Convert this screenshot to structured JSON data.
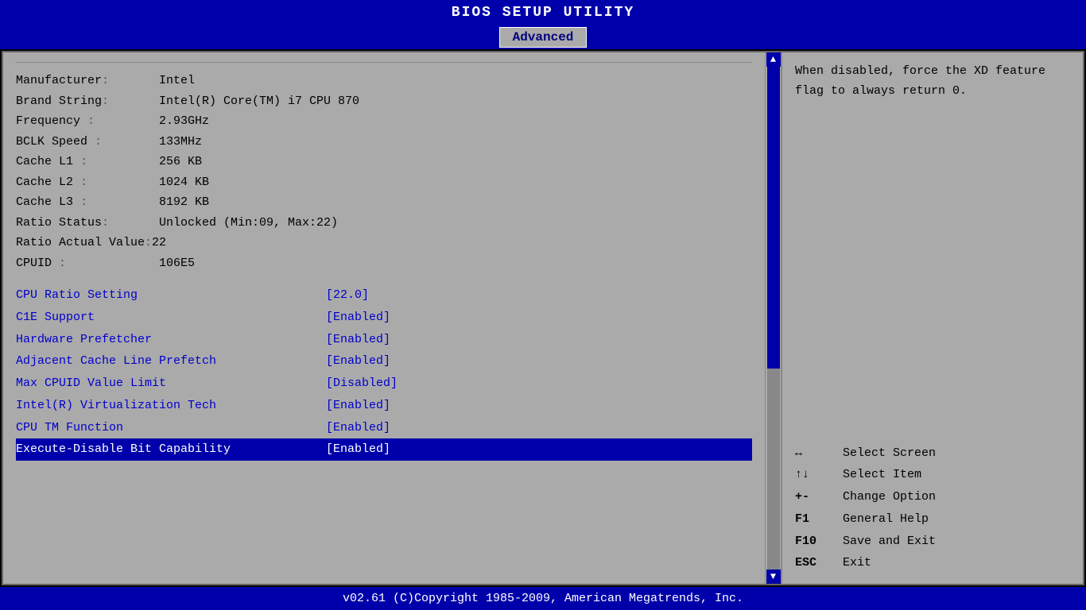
{
  "title": "BIOS SETUP UTILITY",
  "active_tab": "Advanced",
  "info": {
    "manufacturer_label": "Manufacturer",
    "manufacturer_value": "Intel",
    "brand_label": "Brand String",
    "brand_value": "Intel(R) Core(TM) i7 CPU        870",
    "frequency_label": "Frequency",
    "frequency_value": "2.93GHz",
    "bclk_label": "BCLK Speed",
    "bclk_value": "133MHz",
    "cache_l1_label": "Cache L1",
    "cache_l1_value": "256 KB",
    "cache_l2_label": "Cache L2",
    "cache_l2_value": "1024 KB",
    "cache_l3_label": "Cache L3",
    "cache_l3_value": "8192 KB",
    "ratio_status_label": "Ratio Status",
    "ratio_status_value": "Unlocked (Min:09, Max:22)",
    "ratio_actual_label": "Ratio Actual Value",
    "ratio_actual_value": "22",
    "cpuid_label": "CPUID",
    "cpuid_value": "106E5"
  },
  "menu_items": [
    {
      "label": "CPU Ratio Setting",
      "value": "[22.0]",
      "highlighted": false
    },
    {
      "label": "C1E Support",
      "value": "[Enabled]",
      "highlighted": false
    },
    {
      "label": "Hardware Prefetcher",
      "value": "[Enabled]",
      "highlighted": false
    },
    {
      "label": "Adjacent Cache Line Prefetch",
      "value": "[Enabled]",
      "highlighted": false
    },
    {
      "label": "Max CPUID Value Limit",
      "value": "[Disabled]",
      "highlighted": false
    },
    {
      "label": "Intel(R) Virtualization Tech",
      "value": "[Enabled]",
      "highlighted": false
    },
    {
      "label": "CPU TM Function",
      "value": "[Enabled]",
      "highlighted": false
    },
    {
      "label": "Execute-Disable Bit Capability",
      "value": "[Enabled]",
      "highlighted": true
    }
  ],
  "help_text": "When disabled, force the XD feature flag to always return 0.",
  "nav_help": [
    {
      "key": "↔",
      "action": "Select Screen"
    },
    {
      "key": "↑↓",
      "action": "Select Item"
    },
    {
      "key": "+-",
      "action": "Change Option"
    },
    {
      "key": "F1",
      "action": "General Help"
    },
    {
      "key": "F10",
      "action": "Save and Exit"
    },
    {
      "key": "ESC",
      "action": "Exit"
    }
  ],
  "footer": "v02.61  (C)Copyright 1985-2009, American Megatrends, Inc."
}
